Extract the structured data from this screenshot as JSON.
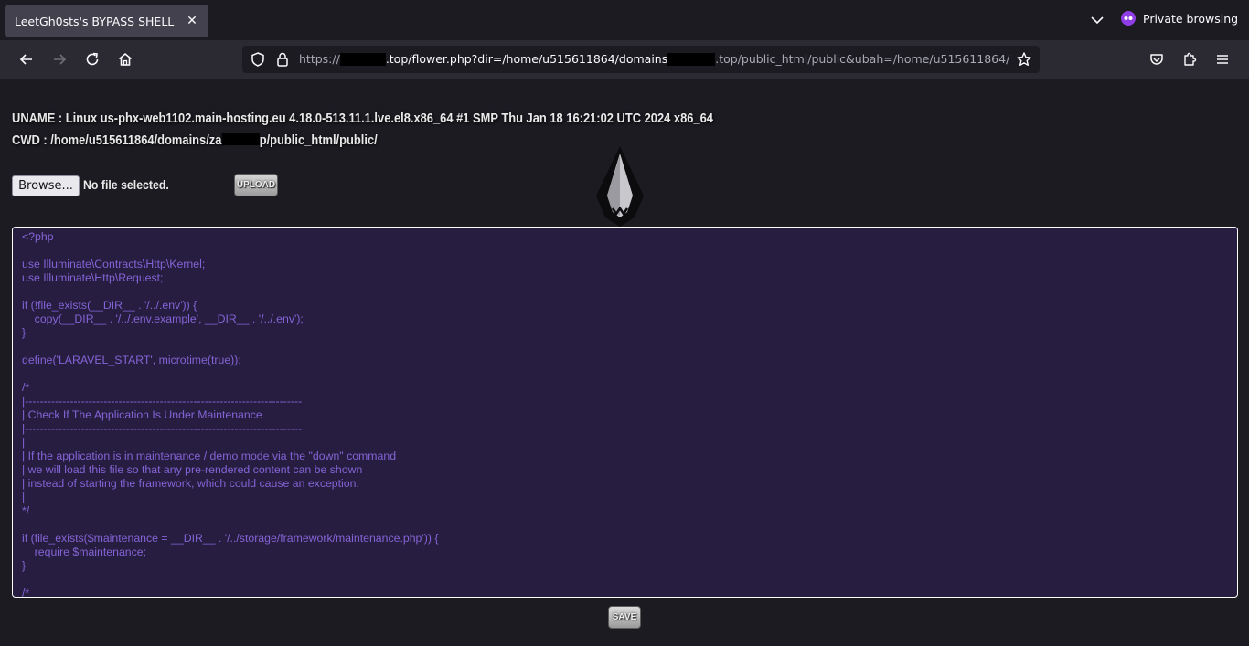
{
  "browser": {
    "tab_title": "LeetGh0sts's BYPASS SHELL",
    "private_label": "Private browsing",
    "url": {
      "prefix": "https://",
      "part1": ".top/flower.php?dir=/home/u515611864/domains",
      "part2": ".top/public_html/public&ubah=/home/u515611864/"
    }
  },
  "page": {
    "uname": "UNAME : Linux us-phx-web1102.main-hosting.eu 4.18.0-513.11.1.lve.el8.x86_64 #1 SMP Thu Jan 18 16:21:02 UTC 2024 x86_64",
    "cwd_prefix": "CWD : /home/u515611864/domains/za",
    "cwd_suffix": "p/public_html/public/",
    "browse_label": "Browse...",
    "file_status": "No file selected.",
    "upload_label": "UPLOAD",
    "save_label": "SAVE",
    "code": "<?php\n\nuse Illuminate\\Contracts\\Http\\Kernel;\nuse Illuminate\\Http\\Request;\n\nif (!file_exists(__DIR__ . '/../.env')) {\n    copy(__DIR__ . '/../.env.example', __DIR__ . '/../.env');\n}\n\ndefine('LARAVEL_START', microtime(true));\n\n/*\n|--------------------------------------------------------------------------\n| Check If The Application Is Under Maintenance\n|--------------------------------------------------------------------------\n|\n| If the application is in maintenance / demo mode via the \"down\" command\n| we will load this file so that any pre-rendered content can be shown\n| instead of starting the framework, which could cause an exception.\n|\n*/\n\nif (file_exists($maintenance = __DIR__ . '/../storage/framework/maintenance.php')) {\n    require $maintenance;\n}\n\n/*"
  },
  "colors": {
    "editor_bg": "#271d40",
    "code_text": "#8364d6",
    "private_accent": "#8f3ee6"
  }
}
